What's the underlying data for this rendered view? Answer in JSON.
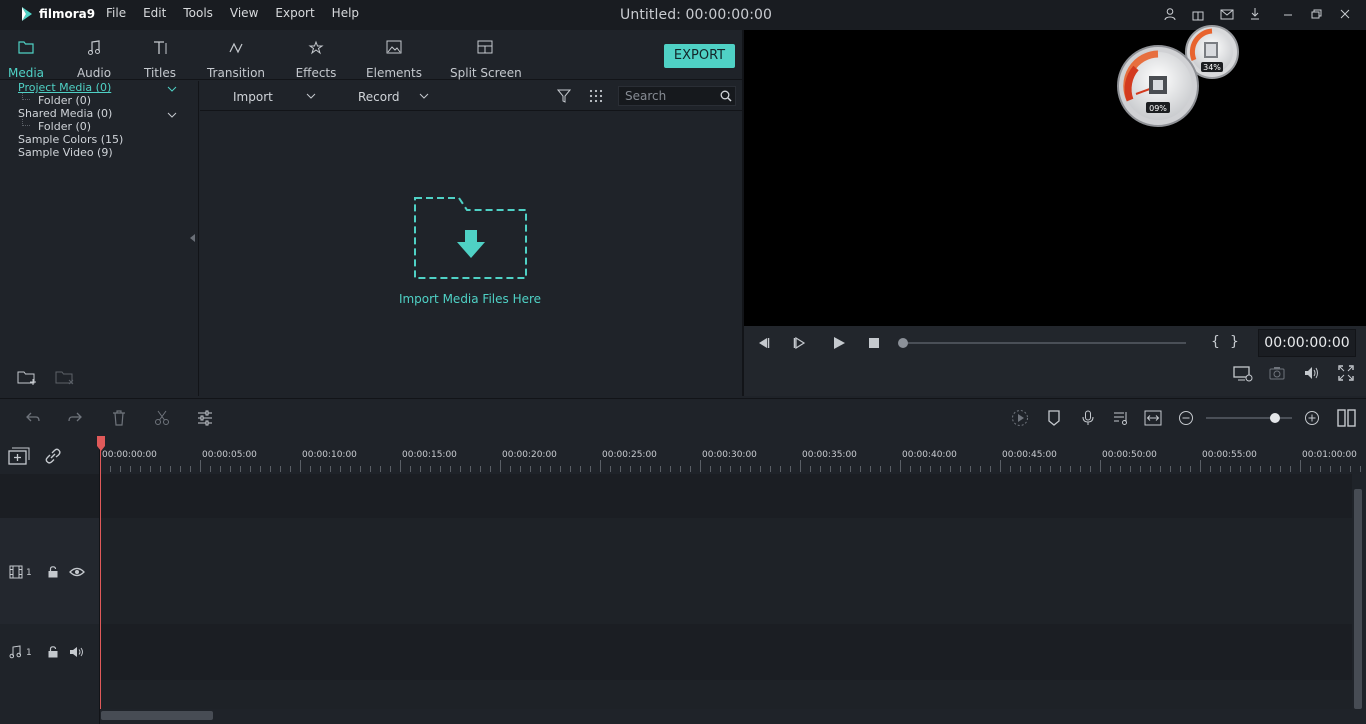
{
  "app": {
    "logo_text": "filmora9",
    "title": "Untitled:  00:00:00:00",
    "menu": [
      "File",
      "Edit",
      "Tools",
      "View",
      "Export",
      "Help"
    ],
    "window_icons": [
      "user-icon",
      "gift-icon",
      "mail-icon",
      "download-icon",
      "minimize-icon",
      "restore-icon",
      "close-icon"
    ]
  },
  "tabs": [
    {
      "label": "Media",
      "icon": "folder-icon",
      "active": true
    },
    {
      "label": "Audio",
      "icon": "music-note-icon"
    },
    {
      "label": "Titles",
      "icon": "text-icon"
    },
    {
      "label": "Transition",
      "icon": "transition-icon"
    },
    {
      "label": "Effects",
      "icon": "effects-icon"
    },
    {
      "label": "Elements",
      "icon": "image-icon"
    },
    {
      "label": "Split Screen",
      "icon": "split-screen-icon"
    }
  ],
  "export_label": "EXPORT",
  "media_tree": [
    {
      "label": "Project Media (0)",
      "active": true
    },
    {
      "label": "Folder (0)"
    },
    {
      "label": "Shared Media (0)"
    },
    {
      "label": "Folder (0)"
    },
    {
      "label": "Sample Colors (15)"
    },
    {
      "label": "Sample Video (9)"
    }
  ],
  "media_toolbar": {
    "import_label": "Import",
    "record_label": "Record",
    "search_placeholder": "Search"
  },
  "import_hint": "Import Media Files Here",
  "preview": {
    "timecode": "00:00:00:00",
    "mark_in": "{",
    "mark_out": "}"
  },
  "gauges": [
    {
      "label": "09%",
      "value": 0.09
    },
    {
      "label": "34%",
      "value": 0.34
    }
  ],
  "timeline": {
    "ticks": [
      "00:00:00:00",
      "00:00:05:00",
      "00:00:10:00",
      "00:00:15:00",
      "00:00:20:00",
      "00:00:25:00",
      "00:00:30:00",
      "00:00:35:00",
      "00:00:40:00",
      "00:00:45:00",
      "00:00:50:00",
      "00:00:55:00",
      "00:01:00:00"
    ],
    "video_track_label": "1",
    "audio_track_label": "1",
    "zoom_level": 0.8,
    "playhead_time": "00:00:00:00"
  },
  "colors": {
    "accent": "#4fd1c5",
    "playhead": "#e05a5a",
    "background": "#1f2329"
  }
}
